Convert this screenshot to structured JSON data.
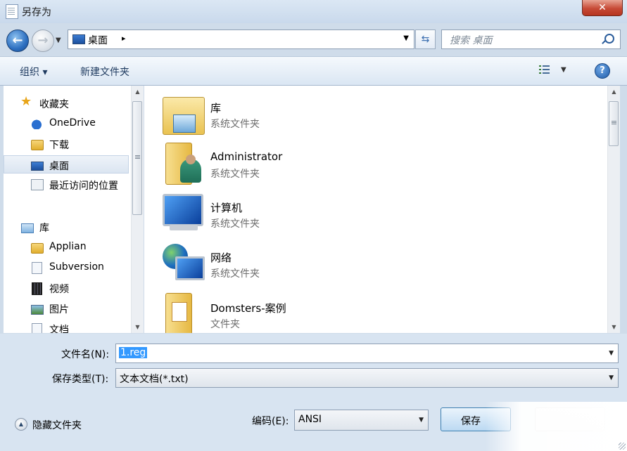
{
  "window": {
    "title": "另存为",
    "close_label": "✕"
  },
  "nav": {
    "address": "桌面",
    "address_sep": "▸",
    "search_placeholder": "搜索 桌面"
  },
  "toolbar": {
    "organize_label": "组织 ▾",
    "new_folder_label": "新建文件夹",
    "view_drop": "▼",
    "help": "?"
  },
  "sidebar": {
    "items": [
      {
        "label": "收藏夹",
        "icon": "star-icon"
      },
      {
        "label": "OneDrive",
        "icon": "onedrive-icon"
      },
      {
        "label": "下载",
        "icon": "folder-icon"
      },
      {
        "label": "桌面",
        "icon": "desktop-icon",
        "selected": true
      },
      {
        "label": "最近访问的位置",
        "icon": "recent-places-icon"
      },
      {
        "label": "库",
        "icon": "library-icon"
      },
      {
        "label": "Applian",
        "icon": "folder-icon"
      },
      {
        "label": "Subversion",
        "icon": "document-icon"
      },
      {
        "label": "视频",
        "icon": "video-icon"
      },
      {
        "label": "图片",
        "icon": "picture-icon"
      },
      {
        "label": "文档",
        "icon": "document-icon"
      }
    ]
  },
  "files": [
    {
      "name": "库",
      "type": "系统文件夹",
      "icon": "library-icon"
    },
    {
      "name": "Administrator",
      "type": "系统文件夹",
      "icon": "user-folder-icon"
    },
    {
      "name": "计算机",
      "type": "系统文件夹",
      "icon": "computer-icon"
    },
    {
      "name": "网络",
      "type": "系统文件夹",
      "icon": "network-icon"
    },
    {
      "name": "Domsters-案例",
      "type": "文件夹",
      "icon": "folder-icon"
    }
  ],
  "form": {
    "filename_label": "文件名(N):",
    "filename_value": "1.reg",
    "filetype_label": "保存类型(T):",
    "filetype_value": "文本文档(*.txt)",
    "hide_folders_label": "隐藏文件夹",
    "encoding_label": "编码(E):",
    "encoding_value": "ANSI",
    "save_label": "保存"
  }
}
